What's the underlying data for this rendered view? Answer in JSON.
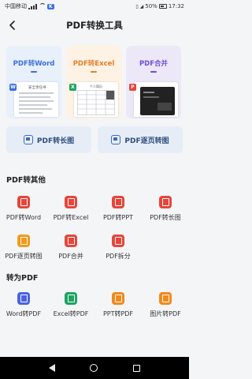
{
  "status_bar": {
    "carrier": "中国移动",
    "network_badge": "K",
    "battery": "50%",
    "time": "17:32"
  },
  "header": {
    "title": "PDF转换工具",
    "back_icon": "chevron-left-icon"
  },
  "feature_cards": [
    {
      "label": "PDF转Word",
      "color": "#3b6fe0",
      "preview_tag": "W",
      "preview_title": "安全责任书"
    },
    {
      "label": "PDF转Excel",
      "color": "#e77f2a",
      "preview_tag": "X",
      "preview_title": "个人简历"
    },
    {
      "label": "PDF合并",
      "color": "#6b4fd6",
      "preview_tag": "P",
      "preview_title": ""
    }
  ],
  "wide_buttons": [
    {
      "label": "PDF转长图"
    },
    {
      "label": "PDF逐页转图"
    }
  ],
  "section_pdf_to_other": {
    "title": "PDF转其他",
    "tools": [
      {
        "label": "PDF转Word",
        "color": "#e5463b"
      },
      {
        "label": "PDF转Excel",
        "color": "#e5463b"
      },
      {
        "label": "PDF转PPT",
        "color": "#e5463b"
      },
      {
        "label": "PDF转长图",
        "color": "#e5463b"
      },
      {
        "label": "PDF逐页转图",
        "color": "#f29a1e"
      },
      {
        "label": "PDF合并",
        "color": "#e5463b"
      },
      {
        "label": "PDF拆分",
        "color": "#e5463b"
      }
    ]
  },
  "section_to_pdf": {
    "title": "转为PDF",
    "tools": [
      {
        "label": "Word转PDF",
        "color": "#4b63e0"
      },
      {
        "label": "Excel转PDF",
        "color": "#1fa463"
      },
      {
        "label": "PPT转PDF",
        "color": "#f08a1c"
      },
      {
        "label": "图片转PDF",
        "color": "#f08a1c"
      }
    ]
  },
  "nav_bar": {
    "back_icon": "triangle-back-icon",
    "home_icon": "circle-home-icon",
    "recent_icon": "square-recent-icon"
  }
}
